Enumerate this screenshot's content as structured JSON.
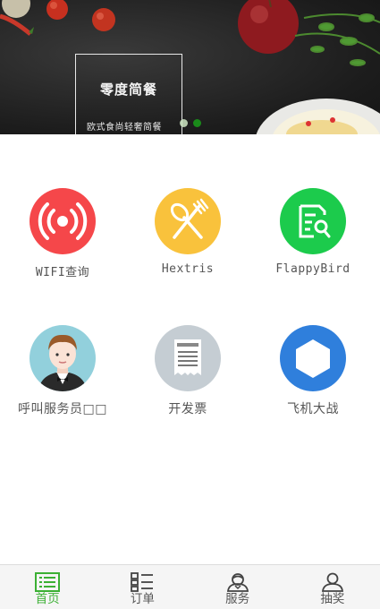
{
  "banner": {
    "title": "零度简餐",
    "subtitle": "欧式食尚轻奢简餐",
    "slides_total": 2,
    "slide_active": 2
  },
  "grid": {
    "items": [
      {
        "label": "WIFI查询",
        "icon": "wifi-signal-icon",
        "color": "#f5474a"
      },
      {
        "label": "Hextris",
        "icon": "fork-spoon-icon",
        "color": "#f9c23c"
      },
      {
        "label": "FlappyBird",
        "icon": "search-document-icon",
        "color": "#1ccb4c"
      },
      {
        "label": "呼叫服务员□□",
        "icon": "waiter-avatar-icon",
        "color": "#92d0dc"
      },
      {
        "label": "开发票",
        "icon": "receipt-icon",
        "color": "#c5cdd3"
      },
      {
        "label": "飞机大战",
        "icon": "hexagon-icon",
        "color": "#2f7fdc"
      }
    ]
  },
  "tabbar": {
    "accent": "#3cb034",
    "tabs": [
      {
        "label": "首页",
        "icon": "home-list-icon",
        "active": true
      },
      {
        "label": "订单",
        "icon": "order-grid-icon",
        "active": false
      },
      {
        "label": "服务",
        "icon": "service-person-icon",
        "active": false
      },
      {
        "label": "抽奖",
        "icon": "user-icon",
        "active": false
      }
    ]
  }
}
